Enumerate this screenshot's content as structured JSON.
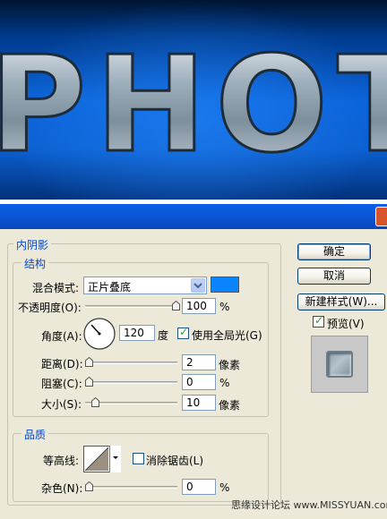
{
  "banner": {
    "text": "PHOT"
  },
  "inner_shadow": {
    "title": "内阴影",
    "structure": {
      "title": "结构",
      "blend_mode_label": "混合模式:",
      "blend_mode_value": "正片叠底",
      "swatch_color": "#0a84ff",
      "opacity_label": "不透明度(O):",
      "opacity_value": "100",
      "opacity_unit": "%",
      "angle_label": "角度(A):",
      "angle_value": "120",
      "angle_unit": "度",
      "global_light_label": "使用全局光(G)",
      "global_light_checked": true,
      "distance_label": "距离(D):",
      "distance_value": "2",
      "distance_unit": "像素",
      "choke_label": "阻塞(C):",
      "choke_value": "0",
      "choke_unit": "%",
      "size_label": "大小(S):",
      "size_value": "10",
      "size_unit": "像素"
    },
    "quality": {
      "title": "品质",
      "contour_label": "等高线:",
      "anti_alias_label": "消除锯齿(L)",
      "anti_alias_checked": false,
      "noise_label": "杂色(N):",
      "noise_value": "0",
      "noise_unit": "%"
    }
  },
  "buttons": {
    "ok": "确定",
    "cancel": "取消",
    "new_style": "新建样式(W)..."
  },
  "preview": {
    "label": "预览(V)",
    "checked": true
  },
  "watermark": "思缘设计论坛 www.MISSYUAN.com"
}
